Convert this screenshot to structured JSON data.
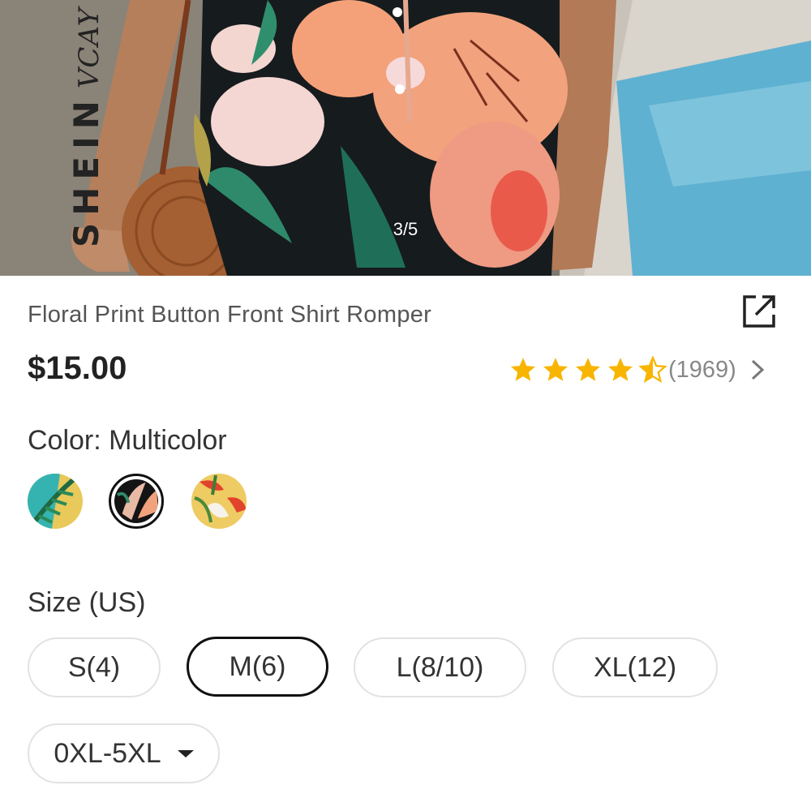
{
  "hero": {
    "brand": "SHEIN",
    "brand_sub": "VCAY",
    "image_counter": "3/5"
  },
  "product": {
    "title": "Floral Print Button Front Shirt Romper",
    "price": "$15.00",
    "rating": 4.5,
    "review_count": "(1969)"
  },
  "icons": {
    "share": "share-icon",
    "chevron": "chevron-right-icon",
    "star": "star-icon"
  },
  "colors": {
    "star": "#f7b500",
    "selected_border": "#111111",
    "pill_border": "#e2e2e2"
  },
  "color_section": {
    "label": "Color: Multicolor",
    "swatches": [
      {
        "name": "teal-yellow-leaf",
        "selected": false
      },
      {
        "name": "black-floral",
        "selected": true
      },
      {
        "name": "yellow-red-floral",
        "selected": false
      }
    ]
  },
  "size_section": {
    "label": "Size (US)",
    "options": [
      "S(4)",
      "M(6)",
      "L(8/10)",
      "XL(12)"
    ],
    "selected": "M(6)",
    "extended": "0XL-5XL"
  }
}
